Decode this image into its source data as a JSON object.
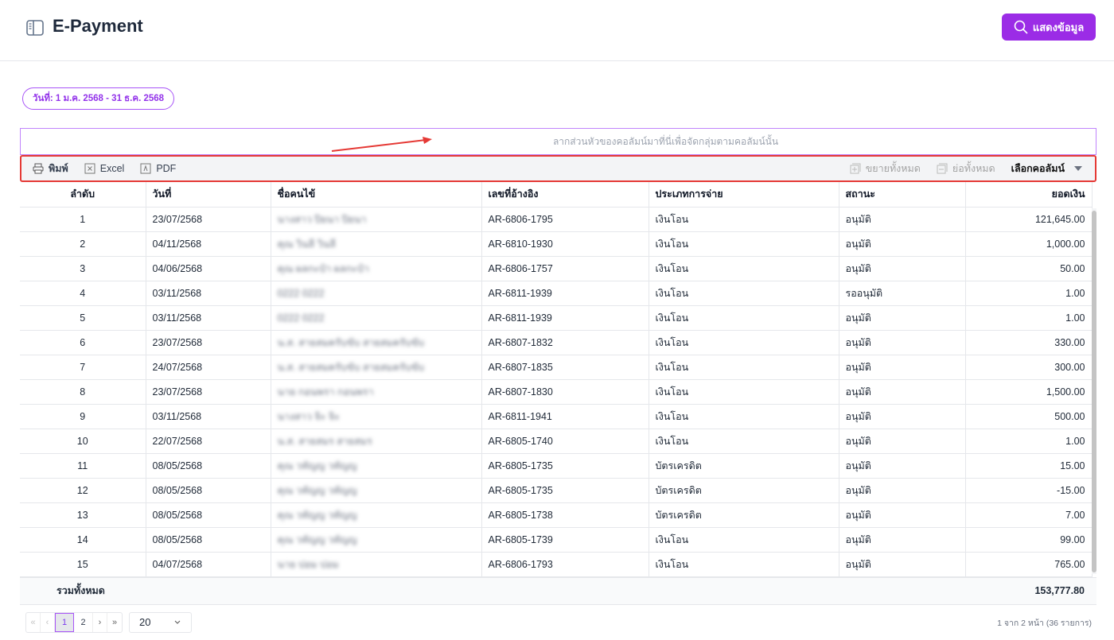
{
  "header": {
    "title": "E-Payment",
    "show_button": "แสดงข้อมูล"
  },
  "filter": {
    "date_range": "วันที่: 1 ม.ค. 2568 - 31 ธ.ค. 2568"
  },
  "grid": {
    "group_panel_hint": "ลากส่วนหัวของคอลัมน์มาที่นี่เพื่อจัดกลุ่มตามคอลัมน์นั้น",
    "toolbar": {
      "print": "พิมพ์",
      "excel": "Excel",
      "pdf": "PDF",
      "expand_all": "ขยายทั้งหมด",
      "collapse_all": "ย่อทั้งหมด",
      "choose_columns": "เลือกคอลัมน์"
    },
    "columns": [
      "ลำดับ",
      "วันที่",
      "ชื่อคนไข้",
      "เลขที่อ้างอิง",
      "ประเภทการจ่าย",
      "สถานะ",
      "ยอดเงิน"
    ],
    "rows": [
      [
        "1",
        "23/07/2568",
        "นางสาว ปิยนา ปิยนา",
        "AR-6806-1795",
        "เงินโอน",
        "อนุมัติ",
        "121,645.00"
      ],
      [
        "2",
        "04/11/2568",
        "คุณ วินลี วินลี",
        "AR-6810-1930",
        "เงินโอน",
        "อนุมัติ",
        "1,000.00"
      ],
      [
        "3",
        "04/06/2568",
        "คุณ ผลกะป๋า ผลกะป๋า",
        "AR-6806-1757",
        "เงินโอน",
        "อนุมัติ",
        "50.00"
      ],
      [
        "4",
        "03/11/2568",
        "0222 0222",
        "AR-6811-1939",
        "เงินโอน",
        "รออนุมัติ",
        "1.00"
      ],
      [
        "5",
        "03/11/2568",
        "0222 0222",
        "AR-6811-1939",
        "เงินโอน",
        "อนุมัติ",
        "1.00"
      ],
      [
        "6",
        "23/07/2568",
        "น.ส. สายสมครับขับ สายสมครับขับ",
        "AR-6807-1832",
        "เงินโอน",
        "อนุมัติ",
        "330.00"
      ],
      [
        "7",
        "24/07/2568",
        "น.ส. สายสมครับขับ สายสมครับขับ",
        "AR-6807-1835",
        "เงินโอน",
        "อนุมัติ",
        "300.00"
      ],
      [
        "8",
        "23/07/2568",
        "นาย กอนพรา กอนพรา",
        "AR-6807-1830",
        "เงินโอน",
        "อนุมัติ",
        "1,500.00"
      ],
      [
        "9",
        "03/11/2568",
        "นางสาว จิะ จิะ",
        "AR-6811-1941",
        "เงินโอน",
        "อนุมัติ",
        "500.00"
      ],
      [
        "10",
        "22/07/2568",
        "น.ส. สายสมร สายสมร",
        "AR-6805-1740",
        "เงินโอน",
        "อนุมัติ",
        "1.00"
      ],
      [
        "11",
        "08/05/2568",
        "คุณ วทัญญ วทัญญ",
        "AR-6805-1735",
        "บัตรเครดิต",
        "อนุมัติ",
        "15.00"
      ],
      [
        "12",
        "08/05/2568",
        "คุณ วทัญญ วทัญญ",
        "AR-6805-1735",
        "บัตรเครดิต",
        "อนุมัติ",
        "-15.00"
      ],
      [
        "13",
        "08/05/2568",
        "คุณ วทัญญ วทัญญ",
        "AR-6805-1738",
        "บัตรเครดิต",
        "อนุมัติ",
        "7.00"
      ],
      [
        "14",
        "08/05/2568",
        "คุณ วทัญญ วทัญญ",
        "AR-6805-1739",
        "เงินโอน",
        "อนุมัติ",
        "99.00"
      ],
      [
        "15",
        "04/07/2568",
        "นาย ปอม ปอม",
        "AR-6806-1793",
        "เงินโอน",
        "อนุมัติ",
        "765.00"
      ]
    ],
    "total_label": "รวมทั้งหมด",
    "total_value": "153,777.80"
  },
  "pager": {
    "first": "«",
    "prev": "‹",
    "pages": [
      "1",
      "2"
    ],
    "next": "›",
    "last": "»",
    "page_size": "20",
    "info": "1 จาก 2 หน้า (36 รายการ)"
  },
  "colors": {
    "accent": "#9b2ce6",
    "annotation": "#e53935"
  }
}
